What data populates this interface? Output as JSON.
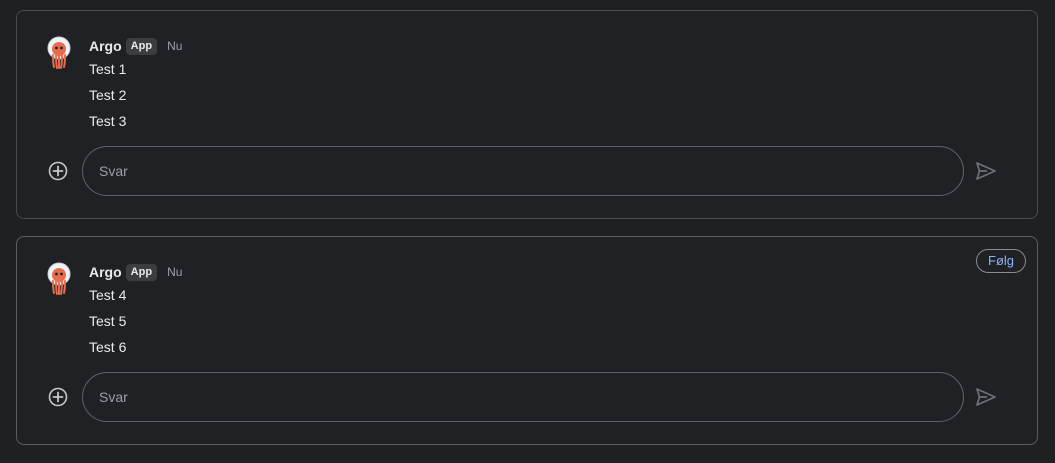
{
  "threads": [
    {
      "sender": "Argo",
      "badge": "App",
      "time": "Nu",
      "lines": [
        "Test 1",
        "Test 2",
        "Test 3"
      ],
      "reply_placeholder": "Svar",
      "follow_label": ""
    },
    {
      "sender": "Argo",
      "badge": "App",
      "time": "Nu",
      "lines": [
        "Test 4",
        "Test 5",
        "Test 6"
      ],
      "reply_placeholder": "Svar",
      "follow_label": "Følg"
    }
  ],
  "icons": {
    "avatar": "argo-octopus-avatar",
    "add": "add-circle-icon",
    "send": "send-icon"
  },
  "colors": {
    "background": "#1f2023",
    "text": "#e8eaed",
    "muted": "#9aa0a6",
    "accent": "#8ab4f8",
    "avatar_orange": "#e96d4c"
  }
}
